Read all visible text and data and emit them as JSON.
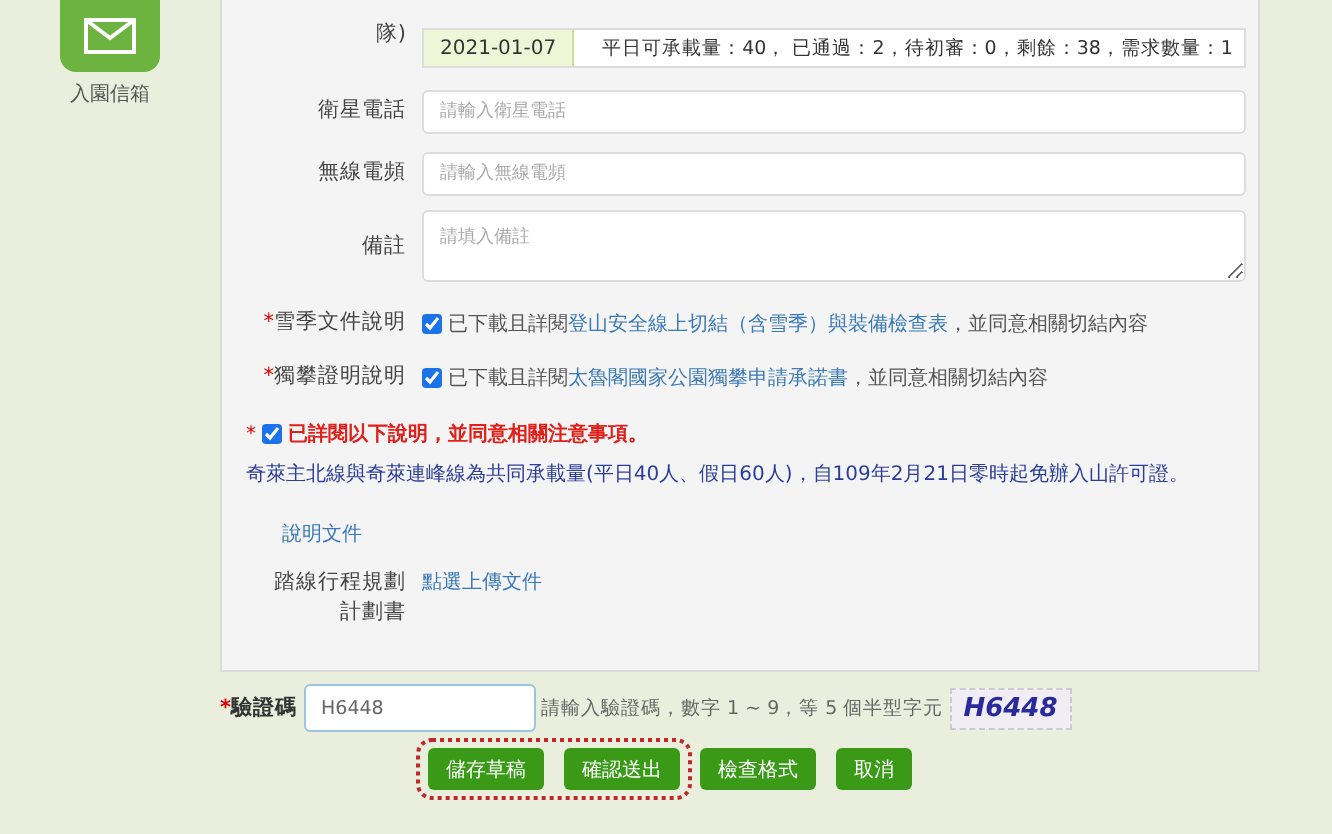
{
  "sidebar": {
    "items": [
      {
        "label": "入園信箱"
      }
    ]
  },
  "form": {
    "quota_row": {
      "label": "隊)",
      "date": "2021-01-07",
      "summary": "平日可承載量：40， 已通過：2，待初審：0，剩餘：38，需求數量：1"
    },
    "fields": [
      {
        "kind": "input",
        "label": "衛星電話",
        "placeholder": "請輸入衛星電話"
      },
      {
        "kind": "input",
        "label": "無線電頻",
        "placeholder": "請輸入無線電頻"
      },
      {
        "kind": "textarea",
        "label": "備註",
        "placeholder": "請填入備註"
      }
    ],
    "agreements": [
      {
        "label": "雪季文件說明",
        "mark": "*",
        "checked": true,
        "before": "已下載且詳閱",
        "link": "登山安全線上切結（含雪季）與裝備檢查表",
        "after": "，並同意相關切結內容"
      },
      {
        "label": "獨攀證明說明",
        "mark": "*",
        "checked": true,
        "before": "已下載且詳閱",
        "link": "太魯閣國家公園獨攀申請承諾書",
        "after": "，並同意相關切結內容"
      }
    ],
    "notice": {
      "mark": "*",
      "checked": true,
      "text": "已詳閱以下說明，並同意相關注意事項。"
    },
    "note": "奇萊主北線與奇萊連峰線為共同承載量(平日40人、假日60人)，自109年2月21日零時起免辦入山許可證。",
    "doc_link": "說明文件",
    "upload": {
      "label": "踏線行程規劃計劃書",
      "link": "點選上傳文件"
    }
  },
  "captcha": {
    "label": "驗證碼",
    "mark": "*",
    "value": "H6448",
    "hint": "請輸入驗證碼，數字 1 ~ 9，等 5 個半型字元",
    "image_text": "H6448"
  },
  "buttons": [
    {
      "label": "儲存草稿",
      "highlighted": true
    },
    {
      "label": "確認送出",
      "highlighted": true
    },
    {
      "label": "檢查格式",
      "highlighted": false
    },
    {
      "label": "取消",
      "highlighted": false
    }
  ]
}
